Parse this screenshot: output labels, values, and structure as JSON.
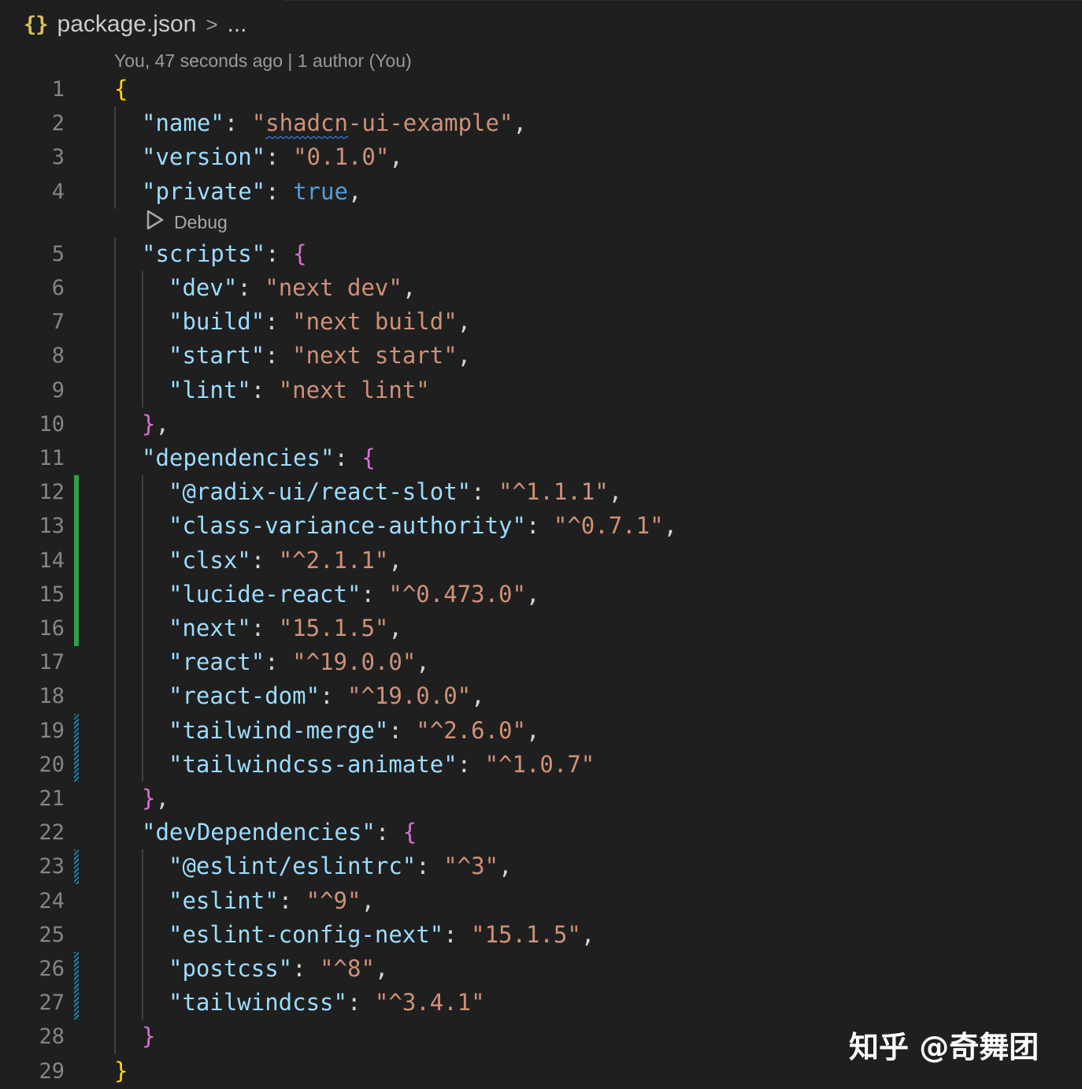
{
  "breadcrumb": {
    "icon": "{}",
    "file": "package.json",
    "separator": ">",
    "more": "..."
  },
  "blame": "You, 47 seconds ago | 1 author (You)",
  "codelens": {
    "label": "Debug"
  },
  "line_numbers": [
    "1",
    "2",
    "3",
    "4",
    "5",
    "6",
    "7",
    "8",
    "9",
    "10",
    "11",
    "12",
    "13",
    "14",
    "15",
    "16",
    "17",
    "18",
    "19",
    "20",
    "21",
    "22",
    "23",
    "24",
    "25",
    "26",
    "27",
    "28",
    "29"
  ],
  "code_lines": [
    [
      {
        "t": "{",
        "c": "br1"
      }
    ],
    [
      {
        "t": "\"name\"",
        "c": "k"
      },
      {
        "t": ": ",
        "c": "p"
      },
      {
        "t": "\"",
        "c": "s"
      },
      {
        "t": "shadcn",
        "c": "s squig"
      },
      {
        "t": "-ui-example\"",
        "c": "s"
      },
      {
        "t": ",",
        "c": "p"
      }
    ],
    [
      {
        "t": "\"version\"",
        "c": "k"
      },
      {
        "t": ": ",
        "c": "p"
      },
      {
        "t": "\"0.1.0\"",
        "c": "s"
      },
      {
        "t": ",",
        "c": "p"
      }
    ],
    [
      {
        "t": "\"private\"",
        "c": "k"
      },
      {
        "t": ": ",
        "c": "p"
      },
      {
        "t": "true",
        "c": "b"
      },
      {
        "t": ",",
        "c": "p"
      }
    ],
    [
      {
        "t": "\"scripts\"",
        "c": "k"
      },
      {
        "t": ": ",
        "c": "p"
      },
      {
        "t": "{",
        "c": "br2"
      }
    ],
    [
      {
        "t": "\"dev\"",
        "c": "k"
      },
      {
        "t": ": ",
        "c": "p"
      },
      {
        "t": "\"next dev\"",
        "c": "s"
      },
      {
        "t": ",",
        "c": "p"
      }
    ],
    [
      {
        "t": "\"build\"",
        "c": "k"
      },
      {
        "t": ": ",
        "c": "p"
      },
      {
        "t": "\"next build\"",
        "c": "s"
      },
      {
        "t": ",",
        "c": "p"
      }
    ],
    [
      {
        "t": "\"start\"",
        "c": "k"
      },
      {
        "t": ": ",
        "c": "p"
      },
      {
        "t": "\"next start\"",
        "c": "s"
      },
      {
        "t": ",",
        "c": "p"
      }
    ],
    [
      {
        "t": "\"lint\"",
        "c": "k"
      },
      {
        "t": ": ",
        "c": "p"
      },
      {
        "t": "\"next lint\"",
        "c": "s"
      }
    ],
    [
      {
        "t": "}",
        "c": "br2"
      },
      {
        "t": ",",
        "c": "p"
      }
    ],
    [
      {
        "t": "\"dependencies\"",
        "c": "k"
      },
      {
        "t": ": ",
        "c": "p"
      },
      {
        "t": "{",
        "c": "br2"
      }
    ],
    [
      {
        "t": "\"@radix-ui/react-slot\"",
        "c": "k"
      },
      {
        "t": ": ",
        "c": "p"
      },
      {
        "t": "\"^1.1.1\"",
        "c": "s"
      },
      {
        "t": ",",
        "c": "p"
      }
    ],
    [
      {
        "t": "\"class-variance-authority\"",
        "c": "k"
      },
      {
        "t": ": ",
        "c": "p"
      },
      {
        "t": "\"^0.7.1\"",
        "c": "s"
      },
      {
        "t": ",",
        "c": "p"
      }
    ],
    [
      {
        "t": "\"clsx\"",
        "c": "k"
      },
      {
        "t": ": ",
        "c": "p"
      },
      {
        "t": "\"^2.1.1\"",
        "c": "s"
      },
      {
        "t": ",",
        "c": "p"
      }
    ],
    [
      {
        "t": "\"lucide-react\"",
        "c": "k"
      },
      {
        "t": ": ",
        "c": "p"
      },
      {
        "t": "\"^0.473.0\"",
        "c": "s"
      },
      {
        "t": ",",
        "c": "p"
      }
    ],
    [
      {
        "t": "\"next\"",
        "c": "k"
      },
      {
        "t": ": ",
        "c": "p"
      },
      {
        "t": "\"15.1.5\"",
        "c": "s"
      },
      {
        "t": ",",
        "c": "p"
      }
    ],
    [
      {
        "t": "\"react\"",
        "c": "k"
      },
      {
        "t": ": ",
        "c": "p"
      },
      {
        "t": "\"^19.0.0\"",
        "c": "s"
      },
      {
        "t": ",",
        "c": "p"
      }
    ],
    [
      {
        "t": "\"react-dom\"",
        "c": "k"
      },
      {
        "t": ": ",
        "c": "p"
      },
      {
        "t": "\"^19.0.0\"",
        "c": "s"
      },
      {
        "t": ",",
        "c": "p"
      }
    ],
    [
      {
        "t": "\"tailwind-merge\"",
        "c": "k"
      },
      {
        "t": ": ",
        "c": "p"
      },
      {
        "t": "\"^2.6.0\"",
        "c": "s"
      },
      {
        "t": ",",
        "c": "p"
      }
    ],
    [
      {
        "t": "\"tailwindcss-animate\"",
        "c": "k"
      },
      {
        "t": ": ",
        "c": "p"
      },
      {
        "t": "\"^1.0.7\"",
        "c": "s"
      }
    ],
    [
      {
        "t": "}",
        "c": "br2"
      },
      {
        "t": ",",
        "c": "p"
      }
    ],
    [
      {
        "t": "\"devDependencies\"",
        "c": "k"
      },
      {
        "t": ": ",
        "c": "p"
      },
      {
        "t": "{",
        "c": "br2"
      }
    ],
    [
      {
        "t": "\"@eslint/eslintrc\"",
        "c": "k"
      },
      {
        "t": ": ",
        "c": "p"
      },
      {
        "t": "\"^3\"",
        "c": "s"
      },
      {
        "t": ",",
        "c": "p"
      }
    ],
    [
      {
        "t": "\"eslint\"",
        "c": "k"
      },
      {
        "t": ": ",
        "c": "p"
      },
      {
        "t": "\"^9\"",
        "c": "s"
      },
      {
        "t": ",",
        "c": "p"
      }
    ],
    [
      {
        "t": "\"eslint-config-next\"",
        "c": "k"
      },
      {
        "t": ": ",
        "c": "p"
      },
      {
        "t": "\"15.1.5\"",
        "c": "s"
      },
      {
        "t": ",",
        "c": "p"
      }
    ],
    [
      {
        "t": "\"postcss\"",
        "c": "k"
      },
      {
        "t": ": ",
        "c": "p"
      },
      {
        "t": "\"^8\"",
        "c": "s"
      },
      {
        "t": ",",
        "c": "p"
      }
    ],
    [
      {
        "t": "\"tailwindcss\"",
        "c": "k"
      },
      {
        "t": ": ",
        "c": "p"
      },
      {
        "t": "\"^3.4.1\"",
        "c": "s"
      }
    ],
    [
      {
        "t": "}",
        "c": "br2"
      }
    ],
    [
      {
        "t": "}",
        "c": "br1"
      }
    ]
  ],
  "watermark": "知乎 @奇舞团",
  "colors": {
    "background": "#1f1f1f",
    "key": "#9cdcfe",
    "string": "#ce9178",
    "boolean": "#569cd6",
    "bracket_outer": "#ffd700",
    "bracket_inner": "#da70d6",
    "gutter_added": "#2ea043",
    "gutter_modified": "#1b81a8"
  }
}
